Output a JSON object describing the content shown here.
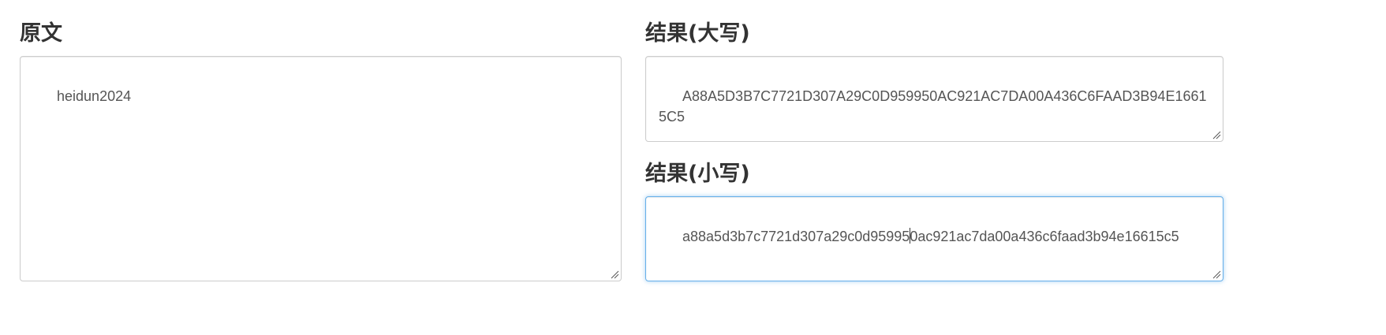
{
  "source": {
    "heading": "原文",
    "value": "heidun2024"
  },
  "upper": {
    "heading": "结果(大写)",
    "value": "A88A5D3B7C7721D307A29C0D959950AC921AC7DA00A436C6FAAD3B94E16615C5"
  },
  "lower": {
    "heading": "结果(小写)",
    "value_before_caret": "a88a5d3b7c7721d307a29c0d95995",
    "value_after_caret": "0ac921ac7da00a436c6faad3b94e16615c5"
  },
  "colors": {
    "focus_border": "#66afe9",
    "border": "#cccccc",
    "heading_text": "#333333",
    "field_text": "#555555"
  }
}
